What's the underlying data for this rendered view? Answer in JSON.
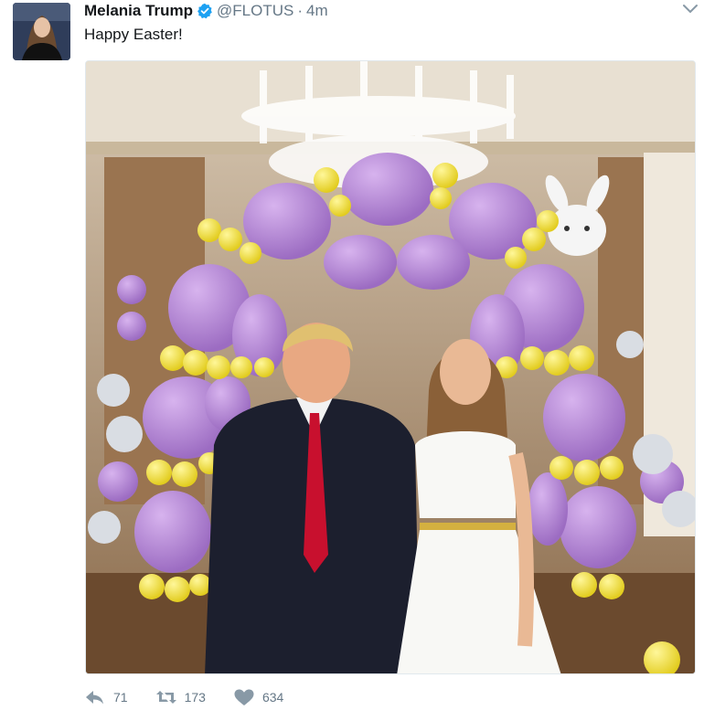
{
  "tweet": {
    "author_name": "Melania Trump",
    "handle": "@FLOTUS",
    "separator": "·",
    "time": "4m",
    "text": "Happy Easter!",
    "verified": true
  },
  "actions": {
    "reply_count": "71",
    "retweet_count": "173",
    "like_count": "634"
  },
  "icons": {
    "verified": "verified-badge-icon",
    "menu": "chevron-down-icon",
    "reply": "reply-icon",
    "retweet": "retweet-icon",
    "like": "heart-icon"
  },
  "colors": {
    "verified_blue": "#1da1f2",
    "icon_gray": "#657786",
    "balloon_purple": "#b27fd4",
    "balloon_yellow": "#f2e23a"
  }
}
